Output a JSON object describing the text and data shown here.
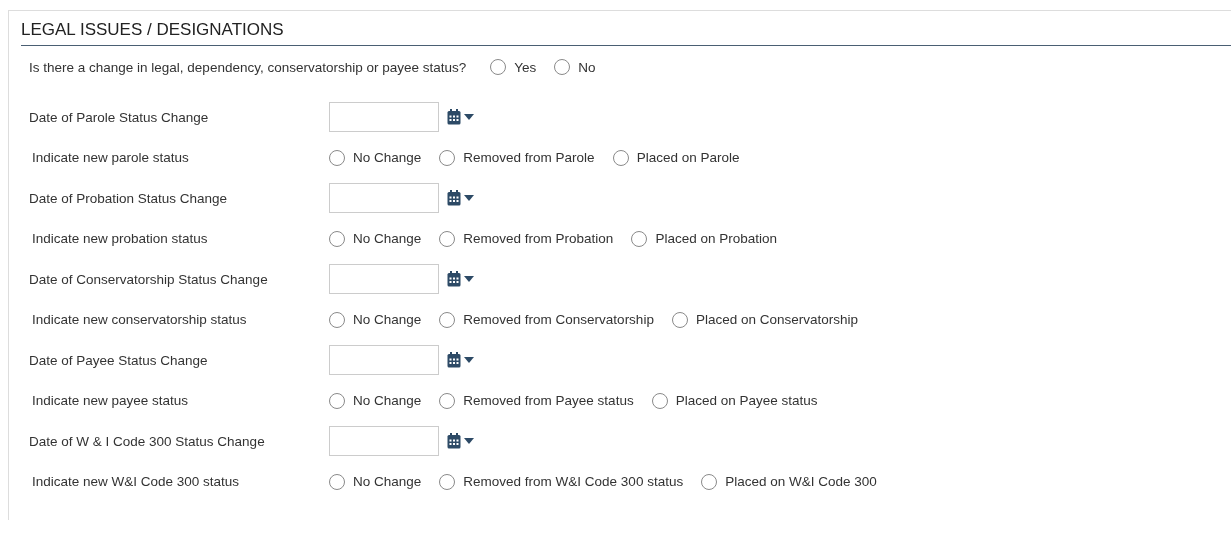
{
  "section": {
    "title": "LEGAL ISSUES / DESIGNATIONS"
  },
  "question": {
    "label": "Is there a change in legal, dependency, conservatorship or payee status?",
    "options": [
      {
        "label": "Yes",
        "selected": false
      },
      {
        "label": "No",
        "selected": false
      }
    ]
  },
  "rows": [
    {
      "kind": "date",
      "label": "Date of Parole Status Change"
    },
    {
      "kind": "radio",
      "label": "Indicate new parole status",
      "options": [
        {
          "label": "No Change",
          "selected": false
        },
        {
          "label": "Removed from Parole",
          "selected": false
        },
        {
          "label": "Placed on Parole",
          "selected": false
        }
      ]
    },
    {
      "kind": "date",
      "label": "Date of Probation Status Change"
    },
    {
      "kind": "radio",
      "label": "Indicate new probation status",
      "options": [
        {
          "label": "No Change",
          "selected": false
        },
        {
          "label": "Removed from Probation",
          "selected": false
        },
        {
          "label": "Placed on Probation",
          "selected": false
        }
      ]
    },
    {
      "kind": "date",
      "label": "Date of Conservatorship Status Change"
    },
    {
      "kind": "radio",
      "label": "Indicate new conservatorship status",
      "options": [
        {
          "label": "No Change",
          "selected": false
        },
        {
          "label": "Removed from Conservatorship",
          "selected": false
        },
        {
          "label": "Placed on Conservatorship",
          "selected": false
        }
      ]
    },
    {
      "kind": "date",
      "label": "Date of Payee Status Change"
    },
    {
      "kind": "radio",
      "label": "Indicate new payee status",
      "options": [
        {
          "label": "No Change",
          "selected": false
        },
        {
          "label": "Removed from Payee status",
          "selected": false
        },
        {
          "label": "Placed on Payee status",
          "selected": false
        }
      ]
    },
    {
      "kind": "date",
      "label": "Date of W & I Code 300 Status Change"
    },
    {
      "kind": "radio",
      "label": "Indicate new W&I Code 300 status",
      "options": [
        {
          "label": "No Change",
          "selected": false
        },
        {
          "label": "Removed from W&I Code 300 status",
          "selected": false
        },
        {
          "label": "Placed on W&I Code 300",
          "selected": false
        }
      ]
    }
  ]
}
